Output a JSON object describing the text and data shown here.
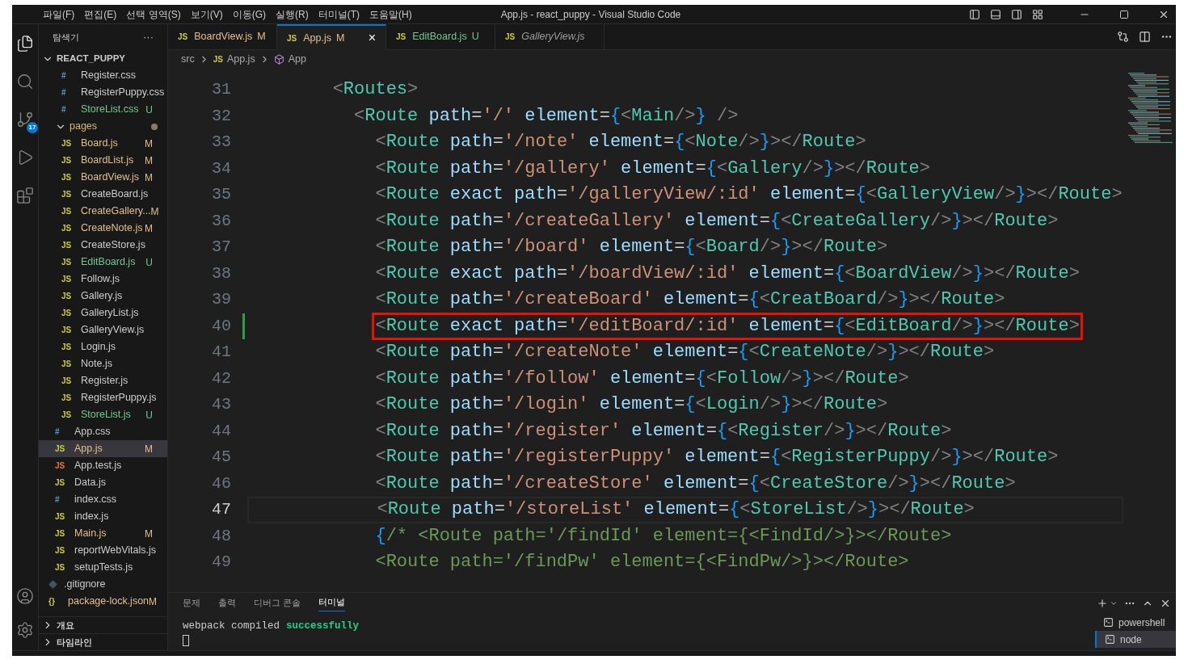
{
  "title_bar": {
    "menu": [
      "파일(F)",
      "편집(E)",
      "선택 영역(S)",
      "보기(V)",
      "이동(G)",
      "실행(R)",
      "터미널(T)",
      "도움말(H)"
    ],
    "title": "App.js - react_puppy - Visual Studio Code"
  },
  "activity_bar": [
    {
      "kind": "files",
      "selected": true
    },
    {
      "kind": "search",
      "selected": false
    },
    {
      "kind": "scm",
      "selected": false,
      "badge": "17"
    },
    {
      "kind": "run",
      "selected": false
    },
    {
      "kind": "extensions",
      "selected": false
    }
  ],
  "explorer": {
    "title": "탐색기",
    "more": "···",
    "tree": [
      {
        "label": "REACT_PUPPY",
        "kind": "folder",
        "expanded": true,
        "children": [
          {
            "children": [
              {
                "children": [
                  {
                    "label": "Register.css",
                    "kind": "css",
                    "icon": "#",
                    "selected": false
                  },
                  {
                    "label": "RegisterPuppy.css",
                    "kind": "css",
                    "icon": "#",
                    "selected": false
                  },
                  {
                    "label": "StoreList.css",
                    "kind": "css",
                    "icon": "#",
                    "status": "U",
                    "selected": false
                  }
                ]
              },
              {
                "label": "pages",
                "kind": "folder",
                "expanded": true,
                "dot": true,
                "children": [
                  {
                    "label": "Board.js",
                    "kind": "js",
                    "icon": "JS",
                    "status": "M",
                    "selected": false
                  },
                  {
                    "label": "BoardList.js",
                    "kind": "js",
                    "icon": "JS",
                    "status": "M",
                    "selected": false
                  },
                  {
                    "label": "BoardView.js",
                    "kind": "js",
                    "icon": "JS",
                    "status": "M",
                    "selected": false
                  },
                  {
                    "label": "CreateBoard.js",
                    "kind": "js",
                    "icon": "JS",
                    "selected": false
                  },
                  {
                    "label": "CreateGallery...",
                    "kind": "js",
                    "icon": "JS",
                    "status": "M",
                    "selected": false
                  },
                  {
                    "label": "CreateNote.js",
                    "kind": "js",
                    "icon": "JS",
                    "status": "M",
                    "selected": false
                  },
                  {
                    "label": "CreateStore.js",
                    "kind": "js",
                    "icon": "JS",
                    "selected": false
                  },
                  {
                    "label": "EditBoard.js",
                    "kind": "js",
                    "icon": "JS",
                    "status": "U",
                    "selected": false
                  },
                  {
                    "label": "Follow.js",
                    "kind": "js",
                    "icon": "JS",
                    "selected": false
                  },
                  {
                    "label": "Gallery.js",
                    "kind": "js",
                    "icon": "JS",
                    "selected": false
                  },
                  {
                    "label": "GalleryList.js",
                    "kind": "js",
                    "icon": "JS",
                    "selected": false
                  },
                  {
                    "label": "GalleryView.js",
                    "kind": "js",
                    "icon": "JS",
                    "selected": false
                  },
                  {
                    "label": "Login.js",
                    "kind": "js",
                    "icon": "JS",
                    "selected": false
                  },
                  {
                    "label": "Note.js",
                    "kind": "js",
                    "icon": "JS",
                    "selected": false
                  },
                  {
                    "label": "Register.js",
                    "kind": "js",
                    "icon": "JS",
                    "selected": false
                  },
                  {
                    "label": "RegisterPuppy.js",
                    "kind": "js",
                    "icon": "JS",
                    "selected": false
                  },
                  {
                    "label": "StoreList.js",
                    "kind": "js",
                    "icon": "JS",
                    "status": "U",
                    "selected": false
                  }
                ]
              },
              {
                "label": "App.css",
                "kind": "css",
                "icon": "#",
                "selected": false
              },
              {
                "label": "App.js",
                "kind": "js",
                "icon": "JS",
                "status": "M",
                "selected": true
              },
              {
                "label": "App.test.js",
                "kind": "test",
                "icon": "JS",
                "selected": false
              },
              {
                "label": "Data.js",
                "kind": "js",
                "icon": "JS",
                "selected": false
              },
              {
                "label": "index.css",
                "kind": "css",
                "icon": "#",
                "selected": false
              },
              {
                "label": "index.js",
                "kind": "js",
                "icon": "JS",
                "selected": false
              },
              {
                "label": "Main.js",
                "kind": "js",
                "icon": "JS",
                "status": "M",
                "selected": false
              },
              {
                "label": "reportWebVitals.js",
                "kind": "js",
                "icon": "JS",
                "selected": false
              },
              {
                "label": "setupTests.js",
                "kind": "js",
                "icon": "JS",
                "selected": false
              }
            ]
          },
          {
            "label": ".gitignore",
            "kind": "git",
            "selected": false
          },
          {
            "label": "package-lock.json",
            "kind": "json",
            "icon": "{}",
            "status": "M",
            "selected": false
          }
        ]
      }
    ],
    "sections": [
      {
        "label": "개요",
        "expanded": false
      },
      {
        "label": "타임라인",
        "expanded": false
      }
    ]
  },
  "tabs": [
    {
      "label": "BoardView.js",
      "icon": "JS",
      "status": "M",
      "selected": false,
      "preview": false
    },
    {
      "label": "App.js",
      "icon": "JS",
      "status": "M",
      "selected": true,
      "preview": false,
      "close": "×"
    },
    {
      "label": "EditBoard.js",
      "icon": "JS",
      "status": "U",
      "selected": false,
      "preview": false
    },
    {
      "label": "GalleryView.js",
      "icon": "JS",
      "selected": false,
      "preview": true
    }
  ],
  "breadcrumb": [
    {
      "label": "src",
      "kind": "folder"
    },
    {
      "label": "App.js",
      "kind": "file",
      "icon": "JS"
    },
    {
      "label": "App",
      "kind": "symbol"
    }
  ],
  "code": [
    {
      "number": "31",
      "current": false,
      "highlighted": false,
      "changed": false,
      "tokens": [
        {
          "kind": "p",
          "text": "        <"
        },
        {
          "kind": "t",
          "text": "Routes"
        },
        {
          "kind": "p",
          "text": ">"
        }
      ]
    },
    {
      "number": "32",
      "current": false,
      "highlighted": false,
      "changed": false,
      "tokens": [
        {
          "kind": "p",
          "text": "          <"
        },
        {
          "kind": "t",
          "text": "Route"
        },
        {
          "kind": "a",
          "text": " path"
        },
        {
          "kind": "o",
          "text": "="
        },
        {
          "kind": "s",
          "text": "'/'"
        },
        {
          "kind": "a",
          "text": " element"
        },
        {
          "kind": "o",
          "text": "="
        },
        {
          "kind": "b",
          "text": "{"
        },
        {
          "kind": "p",
          "text": "<"
        },
        {
          "kind": "t",
          "text": "Main"
        },
        {
          "kind": "p",
          "text": "/>"
        },
        {
          "kind": "b",
          "text": "}"
        },
        {
          "kind": "p",
          "text": " />"
        }
      ]
    },
    {
      "number": "33",
      "current": false,
      "highlighted": false,
      "changed": false,
      "tokens": [
        {
          "kind": "p",
          "text": "            <"
        },
        {
          "kind": "t",
          "text": "Route"
        },
        {
          "kind": "a",
          "text": " path"
        },
        {
          "kind": "o",
          "text": "="
        },
        {
          "kind": "s",
          "text": "'/note'"
        },
        {
          "kind": "a",
          "text": " element"
        },
        {
          "kind": "o",
          "text": "="
        },
        {
          "kind": "b",
          "text": "{"
        },
        {
          "kind": "p",
          "text": "<"
        },
        {
          "kind": "t",
          "text": "Note"
        },
        {
          "kind": "p",
          "text": "/>"
        },
        {
          "kind": "b",
          "text": "}"
        },
        {
          "kind": "p",
          "text": "></"
        },
        {
          "kind": "t",
          "text": "Route"
        },
        {
          "kind": "p",
          "text": ">"
        }
      ]
    },
    {
      "number": "34",
      "current": false,
      "highlighted": false,
      "changed": false,
      "tokens": [
        {
          "kind": "p",
          "text": "            <"
        },
        {
          "kind": "t",
          "text": "Route"
        },
        {
          "kind": "a",
          "text": " path"
        },
        {
          "kind": "o",
          "text": "="
        },
        {
          "kind": "s",
          "text": "'/gallery'"
        },
        {
          "kind": "a",
          "text": " element"
        },
        {
          "kind": "o",
          "text": "="
        },
        {
          "kind": "b",
          "text": "{"
        },
        {
          "kind": "p",
          "text": "<"
        },
        {
          "kind": "t",
          "text": "Gallery"
        },
        {
          "kind": "p",
          "text": "/>"
        },
        {
          "kind": "b",
          "text": "}"
        },
        {
          "kind": "p",
          "text": "></"
        },
        {
          "kind": "t",
          "text": "Route"
        },
        {
          "kind": "p",
          "text": ">"
        }
      ]
    },
    {
      "number": "35",
      "current": false,
      "highlighted": false,
      "changed": false,
      "tokens": [
        {
          "kind": "p",
          "text": "            <"
        },
        {
          "kind": "t",
          "text": "Route"
        },
        {
          "kind": "a",
          "text": " exact path"
        },
        {
          "kind": "o",
          "text": "="
        },
        {
          "kind": "s",
          "text": "'/galleryView/:id'"
        },
        {
          "kind": "a",
          "text": " element"
        },
        {
          "kind": "o",
          "text": "="
        },
        {
          "kind": "b",
          "text": "{"
        },
        {
          "kind": "p",
          "text": "<"
        },
        {
          "kind": "t",
          "text": "GalleryView"
        },
        {
          "kind": "p",
          "text": "/>"
        },
        {
          "kind": "b",
          "text": "}"
        },
        {
          "kind": "p",
          "text": "></"
        },
        {
          "kind": "t",
          "text": "Route"
        },
        {
          "kind": "p",
          "text": ">"
        }
      ]
    },
    {
      "number": "36",
      "current": false,
      "highlighted": false,
      "changed": false,
      "tokens": [
        {
          "kind": "p",
          "text": "            <"
        },
        {
          "kind": "t",
          "text": "Route"
        },
        {
          "kind": "a",
          "text": " path"
        },
        {
          "kind": "o",
          "text": "="
        },
        {
          "kind": "s",
          "text": "'/createGallery'"
        },
        {
          "kind": "a",
          "text": " element"
        },
        {
          "kind": "o",
          "text": "="
        },
        {
          "kind": "b",
          "text": "{"
        },
        {
          "kind": "p",
          "text": "<"
        },
        {
          "kind": "t",
          "text": "CreateGallery"
        },
        {
          "kind": "p",
          "text": "/>"
        },
        {
          "kind": "b",
          "text": "}"
        },
        {
          "kind": "p",
          "text": "></"
        },
        {
          "kind": "t",
          "text": "Route"
        },
        {
          "kind": "p",
          "text": ">"
        }
      ]
    },
    {
      "number": "37",
      "current": false,
      "highlighted": false,
      "changed": false,
      "tokens": [
        {
          "kind": "p",
          "text": "            <"
        },
        {
          "kind": "t",
          "text": "Route"
        },
        {
          "kind": "a",
          "text": " path"
        },
        {
          "kind": "o",
          "text": "="
        },
        {
          "kind": "s",
          "text": "'/board'"
        },
        {
          "kind": "a",
          "text": " element"
        },
        {
          "kind": "o",
          "text": "="
        },
        {
          "kind": "b",
          "text": "{"
        },
        {
          "kind": "p",
          "text": "<"
        },
        {
          "kind": "t",
          "text": "Board"
        },
        {
          "kind": "p",
          "text": "/>"
        },
        {
          "kind": "b",
          "text": "}"
        },
        {
          "kind": "p",
          "text": "></"
        },
        {
          "kind": "t",
          "text": "Route"
        },
        {
          "kind": "p",
          "text": ">"
        }
      ]
    },
    {
      "number": "38",
      "current": false,
      "highlighted": false,
      "changed": false,
      "tokens": [
        {
          "kind": "p",
          "text": "            <"
        },
        {
          "kind": "t",
          "text": "Route"
        },
        {
          "kind": "a",
          "text": " exact path"
        },
        {
          "kind": "o",
          "text": "="
        },
        {
          "kind": "s",
          "text": "'/boardView/:id'"
        },
        {
          "kind": "a",
          "text": " element"
        },
        {
          "kind": "o",
          "text": "="
        },
        {
          "kind": "b",
          "text": "{"
        },
        {
          "kind": "p",
          "text": "<"
        },
        {
          "kind": "t",
          "text": "BoardView"
        },
        {
          "kind": "p",
          "text": "/>"
        },
        {
          "kind": "b",
          "text": "}"
        },
        {
          "kind": "p",
          "text": "></"
        },
        {
          "kind": "t",
          "text": "Route"
        },
        {
          "kind": "p",
          "text": ">"
        }
      ]
    },
    {
      "number": "39",
      "current": false,
      "highlighted": false,
      "changed": false,
      "tokens": [
        {
          "kind": "p",
          "text": "            <"
        },
        {
          "kind": "t",
          "text": "Route"
        },
        {
          "kind": "a",
          "text": " path"
        },
        {
          "kind": "o",
          "text": "="
        },
        {
          "kind": "s",
          "text": "'/createBoard'"
        },
        {
          "kind": "a",
          "text": " element"
        },
        {
          "kind": "o",
          "text": "="
        },
        {
          "kind": "b",
          "text": "{"
        },
        {
          "kind": "p",
          "text": "<"
        },
        {
          "kind": "t",
          "text": "CreatBoard"
        },
        {
          "kind": "p",
          "text": "/>"
        },
        {
          "kind": "b",
          "text": "}"
        },
        {
          "kind": "p",
          "text": "></"
        },
        {
          "kind": "t",
          "text": "Route"
        },
        {
          "kind": "p",
          "text": ">"
        }
      ]
    },
    {
      "number": "40",
      "current": false,
      "highlighted": true,
      "changed": true,
      "tokens": [
        {
          "kind": "p",
          "text": "            <"
        },
        {
          "kind": "t",
          "text": "Route"
        },
        {
          "kind": "a",
          "text": " exact path"
        },
        {
          "kind": "o",
          "text": "="
        },
        {
          "kind": "s",
          "text": "'/editBoard/:id'"
        },
        {
          "kind": "a",
          "text": " element"
        },
        {
          "kind": "o",
          "text": "="
        },
        {
          "kind": "b",
          "text": "{"
        },
        {
          "kind": "p",
          "text": "<"
        },
        {
          "kind": "t",
          "text": "EditBoard"
        },
        {
          "kind": "p",
          "text": "/>"
        },
        {
          "kind": "b",
          "text": "}"
        },
        {
          "kind": "p",
          "text": "></"
        },
        {
          "kind": "t",
          "text": "Route"
        },
        {
          "kind": "p",
          "text": ">"
        }
      ]
    },
    {
      "number": "41",
      "current": false,
      "highlighted": false,
      "changed": false,
      "tokens": [
        {
          "kind": "p",
          "text": "            <"
        },
        {
          "kind": "t",
          "text": "Route"
        },
        {
          "kind": "a",
          "text": " path"
        },
        {
          "kind": "o",
          "text": "="
        },
        {
          "kind": "s",
          "text": "'/createNote'"
        },
        {
          "kind": "a",
          "text": " element"
        },
        {
          "kind": "o",
          "text": "="
        },
        {
          "kind": "b",
          "text": "{"
        },
        {
          "kind": "p",
          "text": "<"
        },
        {
          "kind": "t",
          "text": "CreateNote"
        },
        {
          "kind": "p",
          "text": "/>"
        },
        {
          "kind": "b",
          "text": "}"
        },
        {
          "kind": "p",
          "text": "></"
        },
        {
          "kind": "t",
          "text": "Route"
        },
        {
          "kind": "p",
          "text": ">"
        }
      ]
    },
    {
      "number": "42",
      "current": false,
      "highlighted": false,
      "changed": false,
      "tokens": [
        {
          "kind": "p",
          "text": "            <"
        },
        {
          "kind": "t",
          "text": "Route"
        },
        {
          "kind": "a",
          "text": " path"
        },
        {
          "kind": "o",
          "text": "="
        },
        {
          "kind": "s",
          "text": "'/follow'"
        },
        {
          "kind": "a",
          "text": " element"
        },
        {
          "kind": "o",
          "text": "="
        },
        {
          "kind": "b",
          "text": "{"
        },
        {
          "kind": "p",
          "text": "<"
        },
        {
          "kind": "t",
          "text": "Follow"
        },
        {
          "kind": "p",
          "text": "/>"
        },
        {
          "kind": "b",
          "text": "}"
        },
        {
          "kind": "p",
          "text": "></"
        },
        {
          "kind": "t",
          "text": "Route"
        },
        {
          "kind": "p",
          "text": ">"
        }
      ]
    },
    {
      "number": "43",
      "current": false,
      "highlighted": false,
      "changed": false,
      "tokens": [
        {
          "kind": "p",
          "text": "            <"
        },
        {
          "kind": "t",
          "text": "Route"
        },
        {
          "kind": "a",
          "text": " path"
        },
        {
          "kind": "o",
          "text": "="
        },
        {
          "kind": "s",
          "text": "'/login'"
        },
        {
          "kind": "a",
          "text": " element"
        },
        {
          "kind": "o",
          "text": "="
        },
        {
          "kind": "b",
          "text": "{"
        },
        {
          "kind": "p",
          "text": "<"
        },
        {
          "kind": "t",
          "text": "Login"
        },
        {
          "kind": "p",
          "text": "/>"
        },
        {
          "kind": "b",
          "text": "}"
        },
        {
          "kind": "p",
          "text": "></"
        },
        {
          "kind": "t",
          "text": "Route"
        },
        {
          "kind": "p",
          "text": ">"
        }
      ]
    },
    {
      "number": "44",
      "current": false,
      "highlighted": false,
      "changed": false,
      "tokens": [
        {
          "kind": "p",
          "text": "            <"
        },
        {
          "kind": "t",
          "text": "Route"
        },
        {
          "kind": "a",
          "text": " path"
        },
        {
          "kind": "o",
          "text": "="
        },
        {
          "kind": "s",
          "text": "'/register'"
        },
        {
          "kind": "a",
          "text": " element"
        },
        {
          "kind": "o",
          "text": "="
        },
        {
          "kind": "b",
          "text": "{"
        },
        {
          "kind": "p",
          "text": "<"
        },
        {
          "kind": "t",
          "text": "Register"
        },
        {
          "kind": "p",
          "text": "/>"
        },
        {
          "kind": "b",
          "text": "}"
        },
        {
          "kind": "p",
          "text": "></"
        },
        {
          "kind": "t",
          "text": "Route"
        },
        {
          "kind": "p",
          "text": ">"
        }
      ]
    },
    {
      "number": "45",
      "current": false,
      "highlighted": false,
      "changed": false,
      "tokens": [
        {
          "kind": "p",
          "text": "            <"
        },
        {
          "kind": "t",
          "text": "Route"
        },
        {
          "kind": "a",
          "text": " path"
        },
        {
          "kind": "o",
          "text": "="
        },
        {
          "kind": "s",
          "text": "'/registerPuppy'"
        },
        {
          "kind": "a",
          "text": " element"
        },
        {
          "kind": "o",
          "text": "="
        },
        {
          "kind": "b",
          "text": "{"
        },
        {
          "kind": "p",
          "text": "<"
        },
        {
          "kind": "t",
          "text": "RegisterPuppy"
        },
        {
          "kind": "p",
          "text": "/>"
        },
        {
          "kind": "b",
          "text": "}"
        },
        {
          "kind": "p",
          "text": "></"
        },
        {
          "kind": "t",
          "text": "Route"
        },
        {
          "kind": "p",
          "text": ">"
        }
      ]
    },
    {
      "number": "46",
      "current": false,
      "highlighted": false,
      "changed": false,
      "tokens": [
        {
          "kind": "p",
          "text": "            <"
        },
        {
          "kind": "t",
          "text": "Route"
        },
        {
          "kind": "a",
          "text": " path"
        },
        {
          "kind": "o",
          "text": "="
        },
        {
          "kind": "s",
          "text": "'/createStore'"
        },
        {
          "kind": "a",
          "text": " element"
        },
        {
          "kind": "o",
          "text": "="
        },
        {
          "kind": "b",
          "text": "{"
        },
        {
          "kind": "p",
          "text": "<"
        },
        {
          "kind": "t",
          "text": "CreateStore"
        },
        {
          "kind": "p",
          "text": "/>"
        },
        {
          "kind": "b",
          "text": "}"
        },
        {
          "kind": "p",
          "text": "></"
        },
        {
          "kind": "t",
          "text": "Route"
        },
        {
          "kind": "p",
          "text": ">"
        }
      ]
    },
    {
      "number": "47",
      "current": true,
      "highlighted": false,
      "changed": false,
      "tokens": [
        {
          "kind": "p",
          "text": "            <"
        },
        {
          "kind": "t",
          "text": "Route"
        },
        {
          "kind": "a",
          "text": " path"
        },
        {
          "kind": "o",
          "text": "="
        },
        {
          "kind": "s",
          "text": "'/storeList'"
        },
        {
          "kind": "a",
          "text": " element"
        },
        {
          "kind": "o",
          "text": "="
        },
        {
          "kind": "b",
          "text": "{"
        },
        {
          "kind": "p",
          "text": "<"
        },
        {
          "kind": "t",
          "text": "StoreList"
        },
        {
          "kind": "p",
          "text": "/>"
        },
        {
          "kind": "b",
          "text": "}"
        },
        {
          "kind": "p",
          "text": "></"
        },
        {
          "kind": "t",
          "text": "Route"
        },
        {
          "kind": "p",
          "text": ">"
        }
      ]
    },
    {
      "number": "48",
      "current": false,
      "highlighted": false,
      "changed": false,
      "tokens": [
        {
          "kind": "b",
          "text": "            {"
        },
        {
          "kind": "c",
          "text": "/* <Route path='/findId' element={<FindId/>}></Route>"
        }
      ]
    },
    {
      "number": "49",
      "current": false,
      "highlighted": false,
      "changed": false,
      "tokens": [
        {
          "kind": "c",
          "text": "            <Route path='/findPw' element={<FindPw/>}></Route>"
        }
      ]
    }
  ],
  "panel": {
    "tabs": [
      {
        "label": "문제",
        "selected": false
      },
      {
        "label": "출력",
        "selected": false
      },
      {
        "label": "디버그 콘솔",
        "selected": false
      },
      {
        "label": "터미널",
        "selected": true
      }
    ],
    "output": [
      {
        "text": "webpack compiled",
        "kind": "plain"
      },
      {
        "text": "successfully",
        "kind": "success"
      }
    ],
    "terminals": [
      {
        "label": "powershell",
        "selected": false
      },
      {
        "label": "node",
        "selected": true
      }
    ]
  }
}
